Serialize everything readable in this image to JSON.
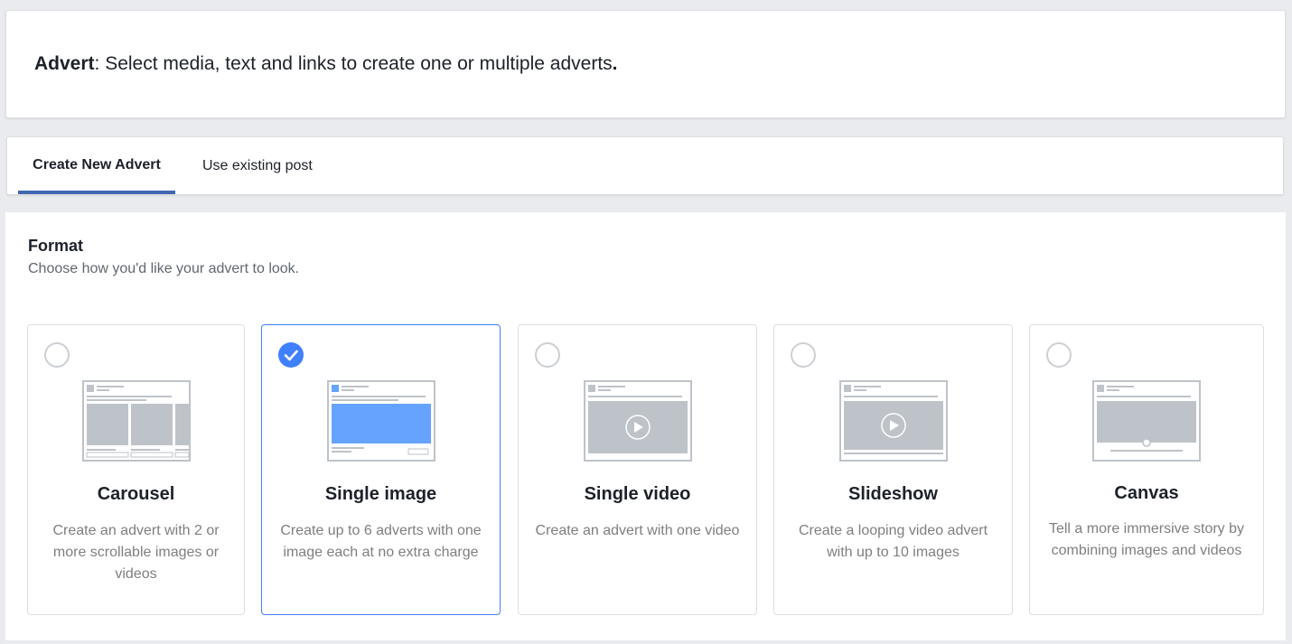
{
  "header": {
    "title_bold": "Advert",
    "title_rest": ": Select media, text and links to create one or multiple adverts",
    "title_period": "."
  },
  "tabs": [
    {
      "label": "Create New Advert",
      "active": true
    },
    {
      "label": "Use existing post",
      "active": false
    }
  ],
  "format": {
    "title": "Format",
    "subtitle": "Choose how you'd like your advert to look.",
    "selected": "Single image",
    "cards": [
      {
        "title": "Carousel",
        "description": "Create an advert with 2 or more scrollable images or videos",
        "icon": "carousel-preview-icon"
      },
      {
        "title": "Single image",
        "description": "Create up to 6 adverts with one image each at no extra charge",
        "icon": "single-image-preview-icon"
      },
      {
        "title": "Single video",
        "description": "Create an advert with one video",
        "icon": "single-video-preview-icon"
      },
      {
        "title": "Slideshow",
        "description": "Create a looping video advert with up to 10 images",
        "icon": "slideshow-preview-icon"
      },
      {
        "title": "Canvas",
        "description": "Tell a more immersive story by combining images and videos",
        "icon": "canvas-preview-icon"
      }
    ]
  },
  "colors": {
    "accent": "#4080ff",
    "tab_underline": "#4267b2",
    "selected_image_fill": "#66a3ff",
    "placeholder_gray": "#bec3c9",
    "page_background": "#e9ebee"
  }
}
